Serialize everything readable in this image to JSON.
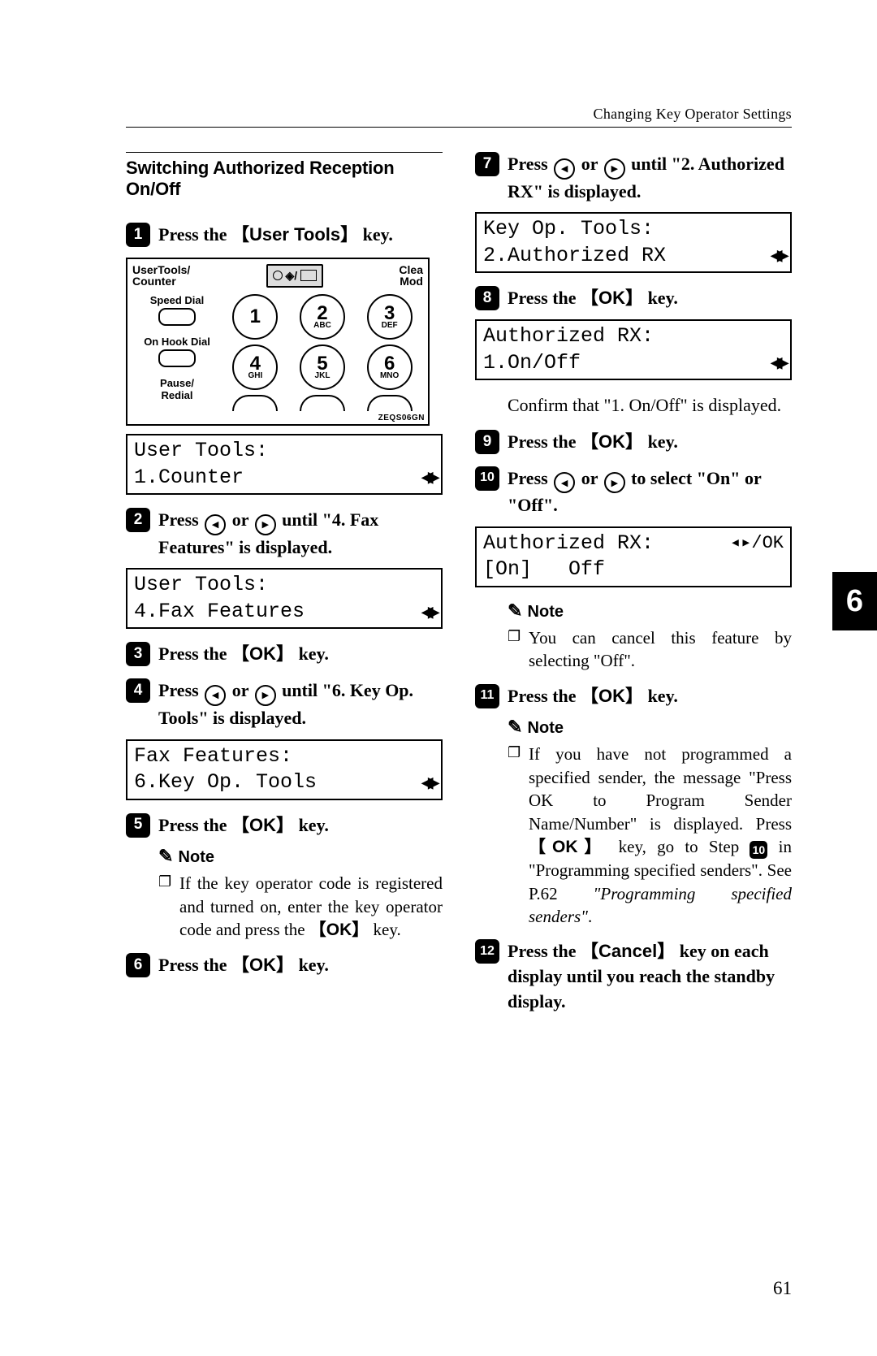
{
  "header": "Changing Key Operator Settings",
  "page_number": "61",
  "chapter_tab": "6",
  "section_title": "Switching Authorized Reception On/Off",
  "keypad": {
    "label_counter": "UserTools/\nCounter",
    "label_clea": "Clea",
    "label_mod": "Mod",
    "left_labels": [
      "Speed Dial",
      "On Hook Dial",
      "Pause/\nRedial"
    ],
    "keys": [
      {
        "n": "1",
        "s": ""
      },
      {
        "n": "2",
        "s": "ABC"
      },
      {
        "n": "3",
        "s": "DEF"
      },
      {
        "n": "4",
        "s": "GHI"
      },
      {
        "n": "5",
        "s": "JKL"
      },
      {
        "n": "6",
        "s": "MNO"
      }
    ],
    "code": "ZEQS06GN"
  },
  "lcd": {
    "s1": {
      "l1": "User Tools:",
      "l2": "1.Counter"
    },
    "s2": {
      "l1": "User Tools:",
      "l2": "4.Fax Features"
    },
    "s4": {
      "l1": "Fax Features:",
      "l2": "6.Key Op. Tools"
    },
    "s7": {
      "l1": "Key Op. Tools:",
      "l2": "2.Authorized RX"
    },
    "s8": {
      "l1": "Authorized RX:",
      "l2": "1.On/Off"
    },
    "s10": {
      "l1": "Authorized RX:",
      "r1": "◂▸/OK",
      "l2": "[On]   Off"
    }
  },
  "steps": {
    "s1": {
      "pre": "Press the ",
      "key": "User Tools",
      "post": " key."
    },
    "s2": {
      "pre": "Press ",
      "mid": " or ",
      "post": " until \"4. Fax Features\" is displayed."
    },
    "s3": {
      "pre": "Press the ",
      "key": "OK",
      "post": " key."
    },
    "s4": {
      "pre": "Press ",
      "mid": " or ",
      "post": " until \"6. Key Op. Tools\" is displayed."
    },
    "s5": {
      "pre": "Press the ",
      "key": "OK",
      "post": " key."
    },
    "s6": {
      "pre": "Press the ",
      "key": "OK",
      "post": " key."
    },
    "s7": {
      "pre": "Press ",
      "mid": " or ",
      "post": " until \"2. Authorized RX\" is displayed."
    },
    "s8": {
      "pre": "Press the ",
      "key": "OK",
      "post": " key."
    },
    "s9": {
      "pre": "Press the ",
      "key": "OK",
      "post": " key."
    },
    "s10": {
      "pre": "Press ",
      "mid": " or ",
      "post": " to select \"On\" or \"Off\"."
    },
    "s11": {
      "pre": "Press the ",
      "key": "OK",
      "post": " key."
    },
    "s12": {
      "pre": "Press the ",
      "key": "Cancel",
      "post": " key on each display until you reach the standby display."
    }
  },
  "body": {
    "confirm": "Confirm that \"1. On/Off\" is displayed.",
    "note_label": "Note",
    "note5": "If the key operator code is registered and turned on, enter the key operator code and press the ",
    "note5_key": "OK",
    "note5_tail": " key.",
    "note10": "You can cancel this feature by selecting \"Off\".",
    "note11a": "If you have not programmed a specified sender, the message \"Press OK to Program Sender Name/Number\" is displayed. Press ",
    "note11a_key": "OK",
    "note11a_mid": " key, go to Step ",
    "note11a_step": "10",
    "note11a_tail": " in \"Programming specified senders\". See P.62 ",
    "note11a_ital": "\"Programming specified senders\"",
    "note11a_end": "."
  }
}
